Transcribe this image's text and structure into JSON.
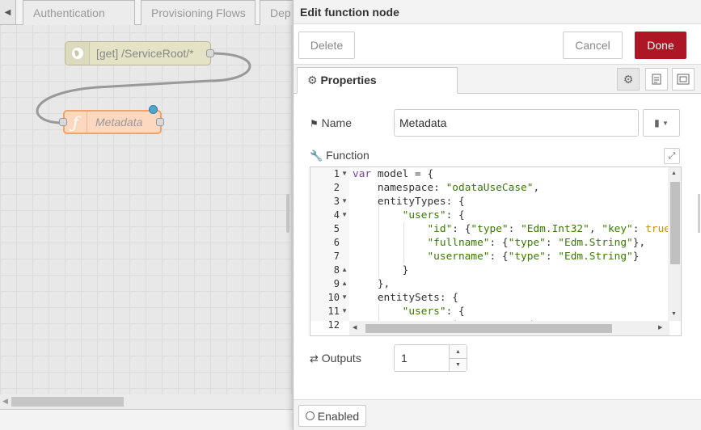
{
  "workspace": {
    "tabs": [
      "Authentication",
      "Provisioning Flows",
      "Dep"
    ],
    "nodes": {
      "http_in": {
        "label": "[get] /ServiceRoot/*"
      },
      "function": {
        "label": "Metadata"
      }
    }
  },
  "tray": {
    "title": "Edit function node",
    "toolbar": {
      "delete_label": "Delete",
      "cancel_label": "Cancel",
      "done_label": "Done"
    },
    "tabs": {
      "properties_label": "Properties"
    },
    "form": {
      "name_label": "Name",
      "name_value": "Metadata",
      "function_label": "Function",
      "outputs_label": "Outputs",
      "outputs_value": "1"
    },
    "editor": {
      "line_numbers": [
        "1",
        "2",
        "3",
        "4",
        "5",
        "6",
        "7",
        "8",
        "9",
        "10",
        "11",
        "12"
      ],
      "lines": [
        "var model = {",
        "    namespace: \"odataUseCase\",",
        "    entityTypes: {",
        "        \"users\": {",
        "            \"id\": {\"type\": \"Edm.Int32\", \"key\": true",
        "            \"fullname\": {\"type\": \"Edm.String\"},",
        "            \"username\": {\"type\": \"Edm.String\"}",
        "        }",
        "    },",
        "    entitySets: {",
        "        \"users\": {",
        "            \"entityType\": \"odataUseCase.users\""
      ]
    },
    "footer": {
      "enabled_label": "Enabled"
    }
  },
  "colors": {
    "done_button": "#ad1625",
    "function_node": "#fbd8bf",
    "http_node": "#e5e3c5",
    "node_status_dot": "#4fa3cf"
  },
  "icons": [
    "globe-icon",
    "function-icon",
    "tag-icon",
    "wrench-icon",
    "gear-icon",
    "file-text-icon",
    "frame-icon",
    "book-icon",
    "expand-icon",
    "shuffle-icon"
  ]
}
